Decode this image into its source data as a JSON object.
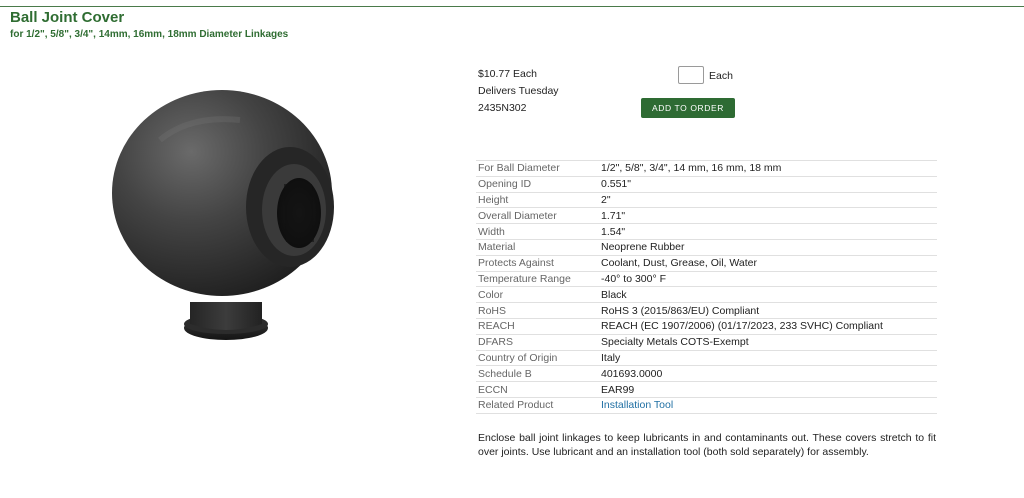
{
  "product": {
    "title": "Ball Joint Cover",
    "subtitle": "for 1/2\", 5/8\", 3/4\", 14mm, 16mm, 18mm Diameter Linkages"
  },
  "purchase": {
    "price": "$10.77 Each",
    "delivery": "Delivers Tuesday",
    "part_number": "2435N302",
    "quantity_value": "",
    "quantity_unit": "Each",
    "add_button": "ADD TO ORDER"
  },
  "specs": [
    {
      "label": "For Ball Diameter",
      "value": "1/2\", 5/8\", 3/4\", 14 mm, 16 mm, 18 mm"
    },
    {
      "label": "Opening ID",
      "value": "0.551\""
    },
    {
      "label": "Height",
      "value": "2\""
    },
    {
      "label": "Overall Diameter",
      "value": "1.71\""
    },
    {
      "label": "Width",
      "value": "1.54\""
    },
    {
      "label": "Material",
      "value": "Neoprene Rubber"
    },
    {
      "label": "Protects Against",
      "value": "Coolant, Dust, Grease, Oil, Water"
    },
    {
      "label": "Temperature Range",
      "value": "-40° to 300° F"
    },
    {
      "label": "Color",
      "value": "Black"
    },
    {
      "label": "RoHS",
      "value": "RoHS 3 (2015/863/EU) Compliant"
    },
    {
      "label": "REACH",
      "value": "REACH (EC 1907/2006) (01/17/2023, 233 SVHC) Compliant"
    },
    {
      "label": "DFARS",
      "value": "Specialty Metals COTS-Exempt"
    },
    {
      "label": "Country of Origin",
      "value": "Italy"
    },
    {
      "label": "Schedule B",
      "value": "401693.0000"
    },
    {
      "label": "ECCN",
      "value": "EAR99"
    },
    {
      "label": "Related Product",
      "value": "Installation Tool"
    }
  ],
  "description": "Enclose ball joint linkages to keep lubricants in and contaminants out. These covers stretch to fit over joints. Use lubricant and an installation tool (both sold separately) for assembly.",
  "colors": {
    "brand_green": "#2f6d32",
    "button_green": "#2e6b33",
    "link_blue": "#1f6fa3"
  }
}
